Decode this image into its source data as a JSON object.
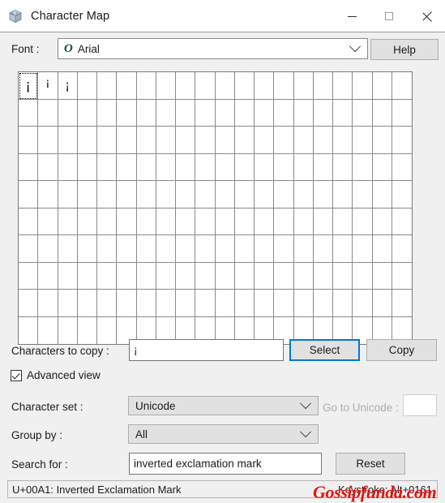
{
  "window": {
    "title": "Character Map",
    "icon": "charmap-cube-icon",
    "controls": {
      "minimize": "minimize-icon",
      "maximize": "maximize-icon",
      "close": "close-icon"
    }
  },
  "font_row": {
    "label": "Font :",
    "value": "Arial",
    "type_icon": "O",
    "help_label": "Help"
  },
  "grid": {
    "columns": 20,
    "rows": 10,
    "selected_index": 0,
    "cells": [
      "¡",
      "¡",
      "¡"
    ]
  },
  "copy_row": {
    "label": "Characters to copy :",
    "value": "¡",
    "select_label": "Select",
    "copy_label": "Copy"
  },
  "advanced_view": {
    "label": "Advanced view",
    "checked": true
  },
  "charset_row": {
    "label": "Character set :",
    "value": "Unicode",
    "goto_label": "Go to Unicode :",
    "goto_value": "",
    "goto_disabled": true
  },
  "groupby_row": {
    "label": "Group by :",
    "value": "All"
  },
  "search_row": {
    "label": "Search for :",
    "value": "inverted exclamation mark",
    "reset_label": "Reset"
  },
  "status": {
    "left": "U+00A1: Inverted Exclamation Mark",
    "right": "Keystroke: Alt+0161"
  },
  "watermark": {
    "text": "Gossipfunda.com",
    "color": "#e8110f"
  },
  "colors": {
    "window_bg": "#f0f0f0",
    "titlebar_bg": "#ffffff",
    "focus_blue": "#0078d7",
    "button_face": "#e1e1e1"
  }
}
